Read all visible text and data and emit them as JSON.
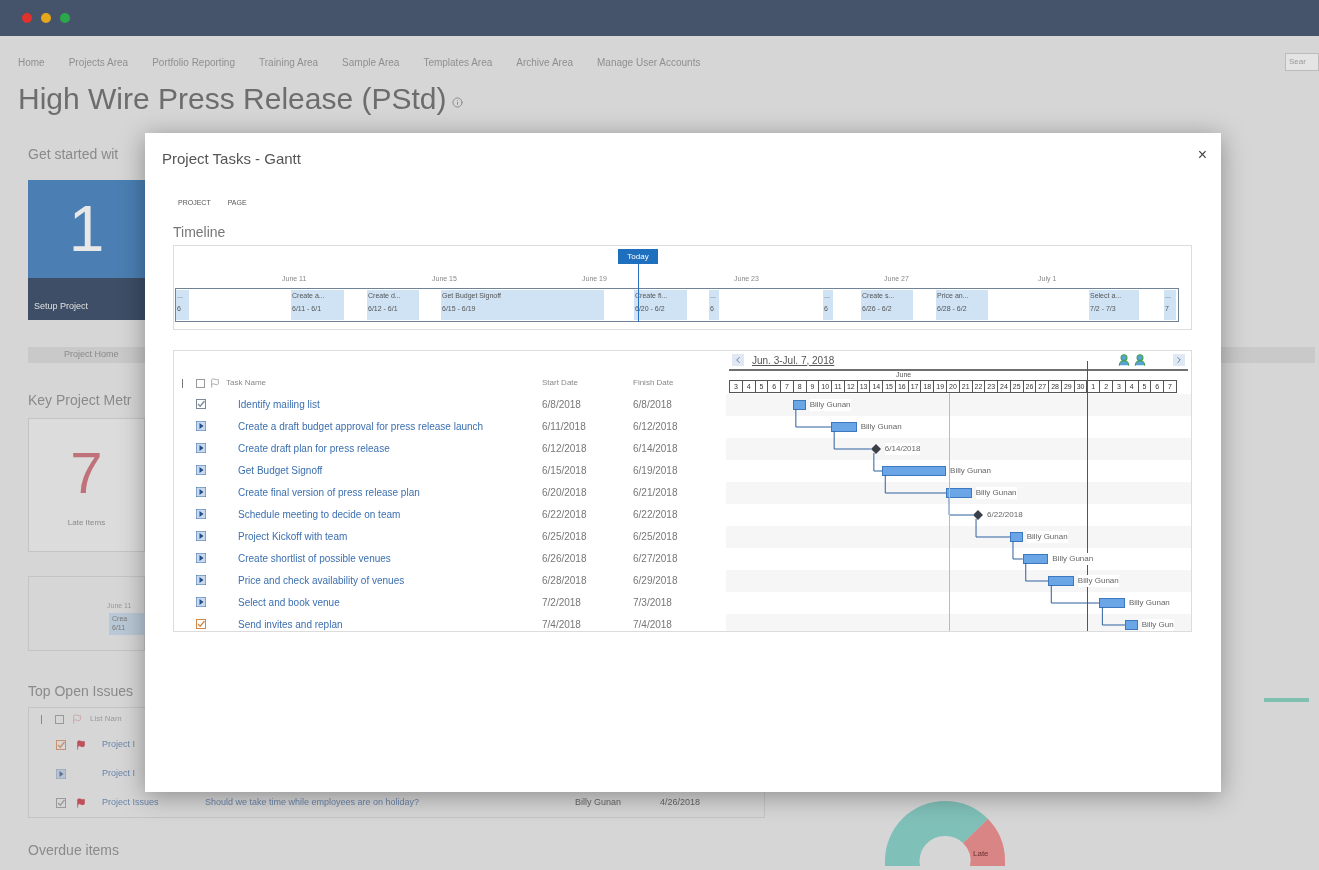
{
  "nav": {
    "links": [
      "Home",
      "Projects Area",
      "Portfolio Reporting",
      "Training Area",
      "Sample Area",
      "Templates Area",
      "Archive Area",
      "Manage User Accounts"
    ],
    "search_placeholder": "Sear"
  },
  "page_title": "High Wire Press Release (PStd)",
  "background": {
    "get_started": "Get started wit",
    "setup_tile": {
      "number": "1",
      "label": "Setup Project"
    },
    "project_home_tab": "Project Home",
    "metrics_heading": "Key Project Metr",
    "late_card": {
      "number": "7",
      "label": "Late Items"
    },
    "mini_timeline": {
      "date": "June 11",
      "task": "Crea",
      "dates": "6/11"
    },
    "issues_heading": "Top Open Issues",
    "issues_header": "List Nam",
    "issues_select_all": {
      "checked": false
    },
    "issues": [
      {
        "kind": "late",
        "flagged": true,
        "list": "Project I"
      },
      {
        "kind": "task",
        "flagged": false,
        "list": "Project I"
      },
      {
        "kind": "done",
        "flagged": true,
        "list": "Project Issues",
        "title": "Should we take time while employees are on holiday?",
        "assigned": "Billy Gunan",
        "due": "4/26/2018"
      }
    ],
    "overdue_heading": "Overdue items",
    "donut_label": "Late"
  },
  "dialog": {
    "title": "Project Tasks - Gantt",
    "close": "×",
    "ribbon_tabs": [
      "PROJECT",
      "PAGE"
    ]
  },
  "timeline": {
    "heading": "Timeline",
    "today": "Today",
    "dates": [
      "June 11",
      "June 15",
      "June 19",
      "June 23",
      "June 27",
      "July 1"
    ],
    "tasks": [
      {
        "name": "...",
        "dates": "6"
      },
      {
        "name": "Create a...",
        "dates": "6/11 - 6/1"
      },
      {
        "name": "Create d...",
        "dates": "6/12 - 6/1"
      },
      {
        "name": "Get Budget Signoff",
        "dates": "6/15 - 6/19"
      },
      {
        "name": "Create fi...",
        "dates": "6/20 - 6/2"
      },
      {
        "name": "...",
        "dates": "6"
      },
      {
        "name": "...",
        "dates": "6"
      },
      {
        "name": "Create s...",
        "dates": "6/26 - 6/2"
      },
      {
        "name": "Price an...",
        "dates": "6/28 - 6/2"
      },
      {
        "name": "Select a...",
        "dates": "7/2 - 7/3"
      },
      {
        "name": "...",
        "dates": "7"
      }
    ]
  },
  "tasks": {
    "columns": [
      "Task Name",
      "Start Date",
      "Finish Date"
    ],
    "select_all": {
      "checked": false
    },
    "rows": [
      {
        "kind": "done",
        "name": "Identify mailing list",
        "start": "6/8/2018",
        "finish": "6/8/2018",
        "gantt": {
          "kind": "bar",
          "label": "Billy Gunan"
        }
      },
      {
        "kind": "task",
        "name": "Create a draft budget approval for press release launch",
        "start": "6/11/2018",
        "finish": "6/12/2018",
        "gantt": {
          "kind": "bar",
          "label": "Billy Gunan"
        }
      },
      {
        "kind": "task",
        "name": "Create draft plan for press release",
        "start": "6/12/2018",
        "finish": "6/14/2018",
        "gantt": {
          "kind": "milestone",
          "label": "6/14/2018"
        }
      },
      {
        "kind": "task",
        "name": "Get Budget Signoff",
        "start": "6/15/2018",
        "finish": "6/19/2018",
        "gantt": {
          "kind": "bar",
          "label": "Billy Gunan"
        }
      },
      {
        "kind": "task",
        "name": "Create final version of press release plan",
        "start": "6/20/2018",
        "finish": "6/21/2018",
        "gantt": {
          "kind": "bar",
          "label": "Billy Gunan"
        }
      },
      {
        "kind": "task",
        "name": "Schedule meeting to decide on team",
        "start": "6/22/2018",
        "finish": "6/22/2018",
        "gantt": {
          "kind": "milestone",
          "label": "6/22/2018"
        }
      },
      {
        "kind": "task",
        "name": "Project Kickoff with team",
        "start": "6/25/2018",
        "finish": "6/25/2018",
        "gantt": {
          "kind": "bar",
          "label": "Billy Gunan"
        }
      },
      {
        "kind": "task",
        "name": "Create shortlist of possible venues",
        "start": "6/26/2018",
        "finish": "6/27/2018",
        "gantt": {
          "kind": "bar",
          "label": "Billy Gunan"
        }
      },
      {
        "kind": "task",
        "name": "Price and check availability of venues",
        "start": "6/28/2018",
        "finish": "6/29/2018",
        "gantt": {
          "kind": "bar",
          "label": "Billy Gunan"
        }
      },
      {
        "kind": "task",
        "name": "Select and book venue",
        "start": "7/2/2018",
        "finish": "7/3/2018",
        "gantt": {
          "kind": "bar",
          "label": "Billy Gunan"
        }
      },
      {
        "kind": "late",
        "name": "Send invites and replan",
        "start": "7/4/2018",
        "finish": "7/4/2018",
        "gantt": {
          "kind": "bar",
          "label": "Billy Gun"
        }
      }
    ]
  },
  "gantt": {
    "range": "Jun. 3-Jul. 7, 2018",
    "month": "June",
    "days": [
      "3",
      "4",
      "5",
      "6",
      "7",
      "8",
      "9",
      "10",
      "11",
      "12",
      "13",
      "14",
      "15",
      "16",
      "17",
      "18",
      "19",
      "20",
      "21",
      "22",
      "23",
      "24",
      "25",
      "26",
      "27",
      "28",
      "29",
      "30",
      "1",
      "2",
      "3",
      "4",
      "5",
      "6",
      "7"
    ]
  }
}
